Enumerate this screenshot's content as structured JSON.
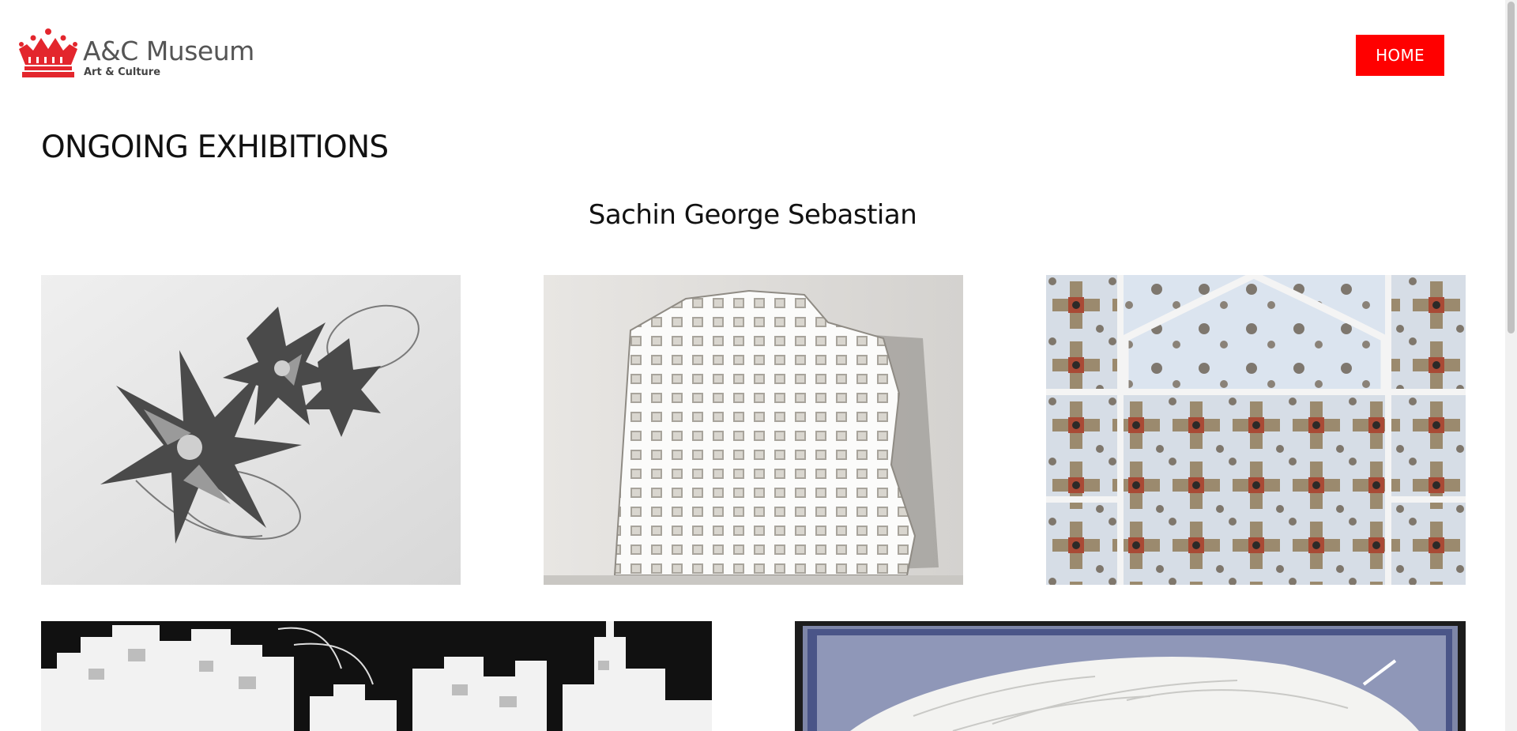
{
  "header": {
    "logo": {
      "title": "A&C Museum",
      "subtitle": "Art & Culture",
      "icon": "crown-icon"
    },
    "nav": {
      "home_label": "HOME"
    }
  },
  "main": {
    "heading": "ONGOING EXHIBITIONS",
    "artist": "Sachin George Sebastian",
    "artworks": [
      {
        "name": "metal-flower-sculpture"
      },
      {
        "name": "paper-cut-window-tower"
      },
      {
        "name": "kaleidoscope-arch-pattern"
      },
      {
        "name": "paper-cityscape"
      },
      {
        "name": "framed-paper-relief"
      }
    ]
  },
  "colors": {
    "accent": "#ff0000",
    "logo": "#e3262d"
  }
}
